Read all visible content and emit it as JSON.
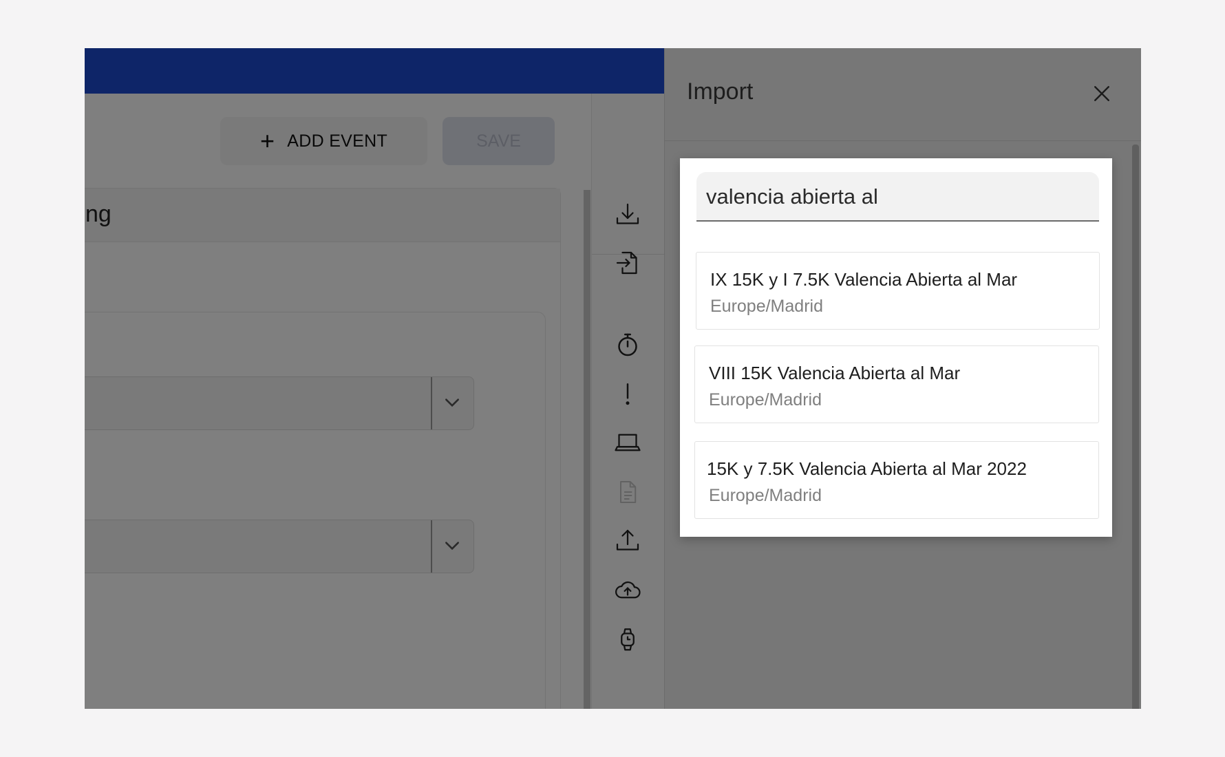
{
  "toolbar": {
    "add_event_icon": "plus-icon",
    "add_event_label": "ADD EVENT",
    "save_label": "SAVE"
  },
  "main_card": {
    "header_text": "ng"
  },
  "rail": {
    "icons": [
      "download-tray-icon",
      "file-import-icon",
      "stopwatch-icon",
      "exclamation-icon",
      "laptop-icon",
      "document-icon",
      "upload-tray-icon",
      "cloud-upload-icon",
      "watch-icon"
    ]
  },
  "drawer": {
    "title": "Import",
    "close_icon": "close-icon",
    "search": {
      "value": "valencia abierta al"
    },
    "results": [
      {
        "name": "IX 15K y I 7.5K Valencia Abierta al Mar",
        "timezone": "Europe/Madrid"
      },
      {
        "name": "VIII 15K Valencia Abierta al Mar",
        "timezone": "Europe/Madrid"
      },
      {
        "name": "15K y 7.5K Valencia Abierta al Mar 2022",
        "timezone": "Europe/Madrid"
      }
    ]
  },
  "colors": {
    "brand_blue": "#1c4ad0",
    "overlay": "#777777",
    "page_bg": "#f5f4f5"
  }
}
